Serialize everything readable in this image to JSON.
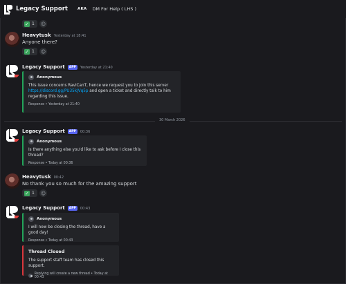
{
  "header": {
    "title": "Legacy Support",
    "aka_label": "AKA",
    "subtitle": "DM For Help ( LHS )"
  },
  "reaction_counts": {
    "check": "1"
  },
  "messages": [
    {
      "author": "Heavytusk",
      "time": "Yesterday at 18:41",
      "text": "Anyone there?"
    },
    {
      "author": "Legacy Support",
      "badge": "APP",
      "time": "Yesterday at 21:40",
      "embed": {
        "author": "Anonymous",
        "line1": "This issue concerns RaviCanT, hence we request you to join this server",
        "link": "https://discord.gg/PU35kJVq5p",
        "line2_suffix": " and open a ticket and directly talk to him",
        "line3": "regarding this issue.",
        "footer": "Response • Yesterday at 21:40"
      }
    },
    {
      "author": "Legacy Support",
      "badge": "APP",
      "time": "00:36",
      "embed": {
        "author": "Anonymous",
        "text": "Is there anything else you'd like to ask before I close this thread?",
        "footer": "Response • Today at 00:36"
      }
    },
    {
      "author": "Heavytusk",
      "time": "00:42",
      "text": "No thank you so much for the amazing support"
    },
    {
      "author": "Legacy Support",
      "badge": "APP",
      "time": "00:43",
      "embed": {
        "author": "Anonymous",
        "text": "I will now be closing the thread, have a good day!",
        "footer": "Response • Today at 00:43"
      },
      "closed_embed": {
        "title": "Thread Closed",
        "text": "The support staff team has closed this support.",
        "footer": "Replying will create a new thread • Today at 00:43"
      }
    }
  ],
  "date_divider": "30 March 2026"
}
